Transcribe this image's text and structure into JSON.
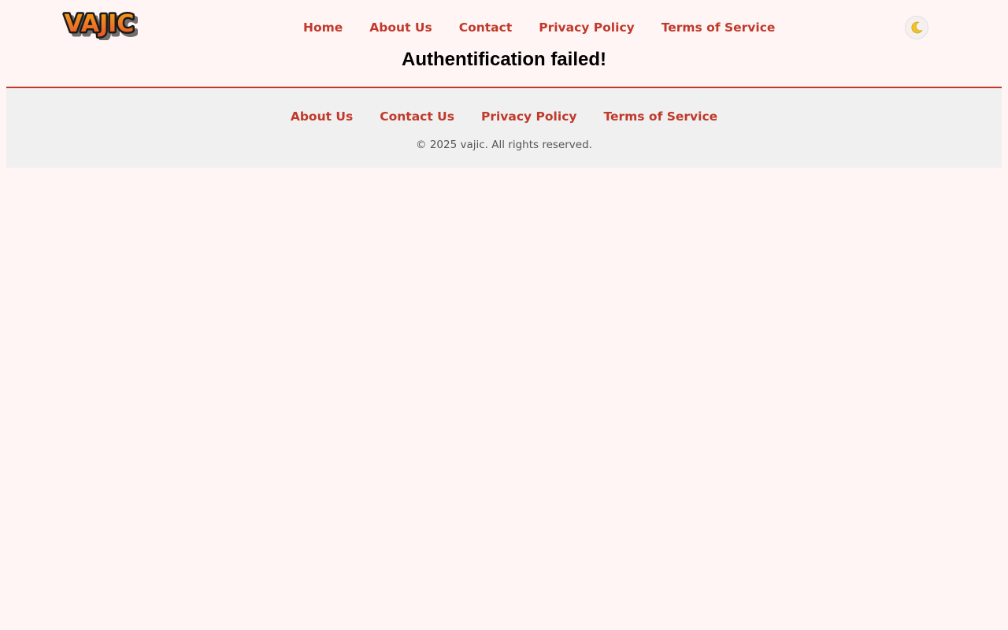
{
  "header": {
    "logo_text": "VAJIC",
    "nav": [
      {
        "label": "Home"
      },
      {
        "label": "About Us"
      },
      {
        "label": "Contact"
      },
      {
        "label": "Privacy Policy"
      },
      {
        "label": "Terms of Service"
      }
    ],
    "theme_toggle_icon": "moon-icon"
  },
  "main": {
    "title": "Authentification failed!"
  },
  "footer": {
    "links": [
      {
        "label": "About Us"
      },
      {
        "label": "Contact Us"
      },
      {
        "label": "Privacy Policy"
      },
      {
        "label": "Terms of Service"
      }
    ],
    "copyright": "© 2025 vajic. All rights reserved."
  },
  "colors": {
    "background": "#fff5f4",
    "accent": "#c0392b",
    "footer_background": "#f0f0f0",
    "muted_text": "#555555",
    "logo_gradient_top": "#f6a21a",
    "logo_gradient_bottom": "#e8512a"
  }
}
